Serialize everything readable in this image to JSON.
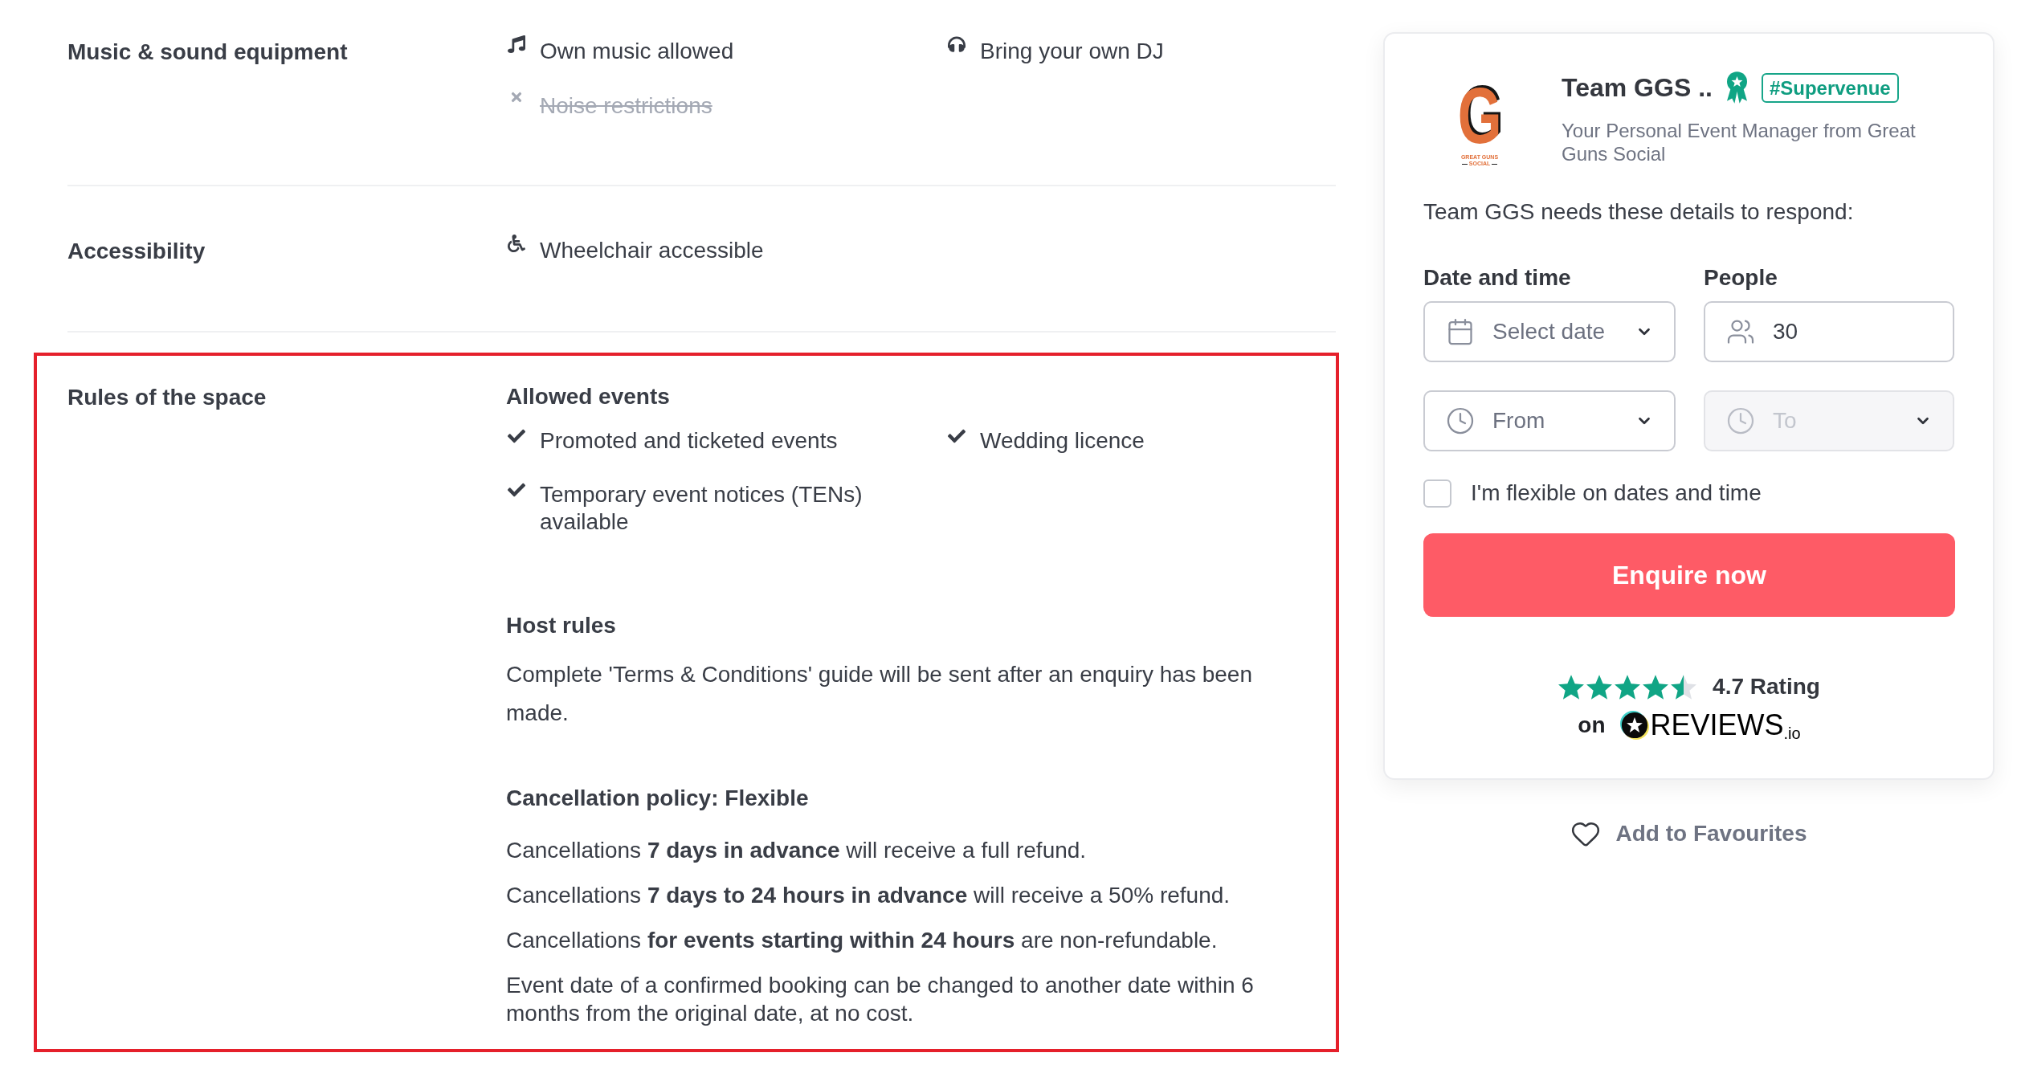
{
  "sections": [
    {
      "label": "Music & sound equipment",
      "highlighted": false,
      "kind": "features",
      "items": [
        {
          "text": "Own music allowed",
          "available": true
        },
        {
          "text": "Bring your own DJ",
          "available": true
        },
        {
          "text": "Noise restrictions",
          "available": false
        }
      ]
    },
    {
      "label": "Accessibility",
      "highlighted": false,
      "kind": "features",
      "items": [
        {
          "text": "Wheelchair accessible",
          "available": true
        }
      ]
    },
    {
      "label": "Rules of the space",
      "highlighted": true,
      "kind": "rules",
      "groups": [
        {
          "heading": "Allowed events",
          "kind": "checklist",
          "items": [
            {
              "text": "Promoted and ticketed events",
              "available": true
            },
            {
              "text": "Wedding licence",
              "available": true
            },
            {
              "text": "Temporary event notices (TENs) available",
              "available": true
            }
          ]
        },
        {
          "heading": "Host rules",
          "kind": "note",
          "paragraphs": [
            "Complete 'Terms & Conditions' guide will be sent after an enquiry has been made."
          ]
        },
        {
          "heading": "Cancellation policy: Flexible",
          "kind": "policy",
          "paragraphs": [
            "Cancellations **7 days in advance** will receive a full refund.",
            "Cancellations **7 days to 24 hours in advance** will receive a 50% refund.",
            "Cancellations **for events starting within 24 hours** are non-refundable.",
            "Event date of a confirmed booking can be changed to another date within 6 months from the original date, at no cost."
          ]
        }
      ]
    }
  ],
  "enquiry_card": {
    "host": {
      "logo": {
        "letter": "G",
        "caption": [
          "GREAT GUNS",
          "SOCIAL"
        ]
      },
      "name": "Team GGS ..",
      "badge": "#Supervenue",
      "subtitle": "Your Personal Event Manager from Great Guns Social"
    },
    "intro": "Team GGS needs these details to respond:",
    "field_labels": [
      "Date and time",
      "People"
    ],
    "fields": [
      {
        "kind": "date",
        "placeholder": "Select date",
        "disabled": false
      },
      {
        "kind": "people",
        "value": "30",
        "disabled": false
      },
      {
        "kind": "time",
        "placeholder": "From",
        "disabled": false
      },
      {
        "kind": "time",
        "placeholder": "To",
        "disabled": true
      }
    ],
    "flexible": {
      "label": "I'm flexible on dates and time",
      "checked": false
    },
    "submit": "Enquire now",
    "rating": {
      "stars": 4.5,
      "label": "4.7 Rating",
      "on": "on",
      "provider": "REVIEWS$_{.io}$"
    }
  },
  "favourite": {
    "label": "Add to Favourites",
    "saved": false
  }
}
